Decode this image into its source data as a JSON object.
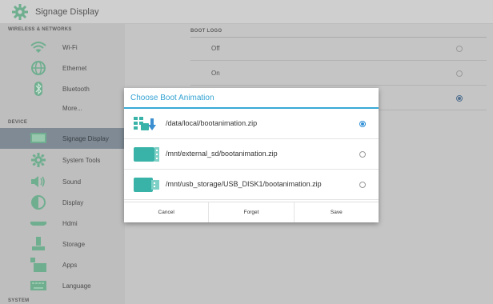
{
  "app": {
    "title": "Signage Display"
  },
  "sidebar": {
    "sections": {
      "wireless": "WIRELESS & NETWORKS",
      "device": "DEVICE",
      "system": "SYSTEM"
    },
    "items": [
      {
        "label": "Wi-Fi",
        "icon": "wifi-icon"
      },
      {
        "label": "Ethernet",
        "icon": "ethernet-icon"
      },
      {
        "label": "Bluetooth",
        "icon": "bluetooth-icon"
      },
      {
        "label": "More...",
        "icon": ""
      },
      {
        "label": "Signage Display",
        "icon": "monitor-icon"
      },
      {
        "label": "System Tools",
        "icon": "gear-icon"
      },
      {
        "label": "Sound",
        "icon": "speaker-icon"
      },
      {
        "label": "Display",
        "icon": "brightness-icon"
      },
      {
        "label": "Hdmi",
        "icon": "hdmi-icon"
      },
      {
        "label": "Storage",
        "icon": "storage-icon"
      },
      {
        "label": "Apps",
        "icon": "apps-icon"
      },
      {
        "label": "Language",
        "icon": "keyboard-icon"
      }
    ]
  },
  "content": {
    "section_label": "BOOT LOGO",
    "options": [
      {
        "label": "Off",
        "selected": false
      },
      {
        "label": "On",
        "selected": false
      },
      {
        "label": "",
        "selected": true
      }
    ]
  },
  "dialog": {
    "title": "Choose Boot Animation",
    "options": [
      {
        "path": "/data/local/bootanimation.zip",
        "icon": "android-download-icon",
        "selected": true
      },
      {
        "path": "/mnt/external_sd/bootanimation.zip",
        "icon": "sd-card-icon",
        "selected": false
      },
      {
        "path": "/mnt/usb_storage/USB_DISK1/bootanimation.zip",
        "icon": "usb-storage-icon",
        "selected": false
      }
    ],
    "buttons": {
      "cancel": "Cancel",
      "forget": "Forget",
      "save": "Save"
    }
  },
  "colors": {
    "accent": "#38a9d6",
    "selected_sidebar": "#7f8a95",
    "sidebar_bg": "#bebebe"
  }
}
